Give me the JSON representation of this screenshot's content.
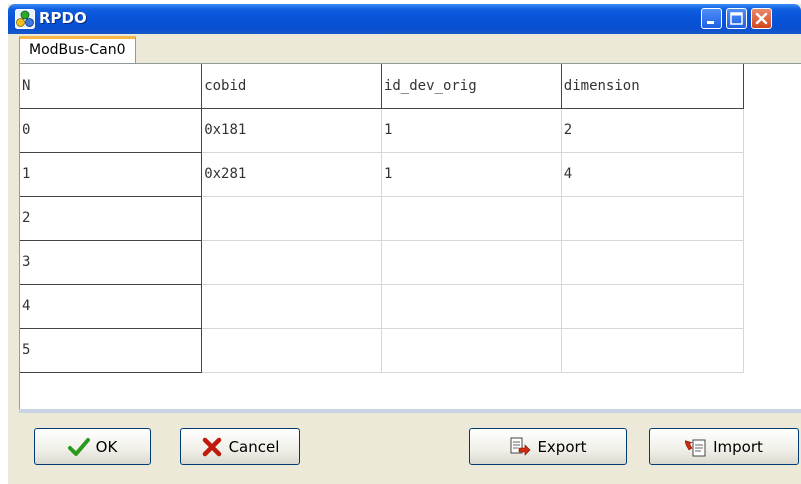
{
  "window": {
    "title": "RPDO",
    "app_icon": "network-nodes-icon",
    "controls": [
      "minimize-icon",
      "maximize-icon",
      "close-icon"
    ]
  },
  "tabs": [
    {
      "label": "ModBus-Can0",
      "active": true
    }
  ],
  "table": {
    "columns": [
      "N",
      "cobid",
      "id_dev_orig",
      "dimension"
    ],
    "rows": [
      [
        "0",
        "0x181",
        "1",
        "2"
      ],
      [
        "1",
        "0x281",
        "1",
        "4"
      ],
      [
        "2",
        "",
        "",
        ""
      ],
      [
        "3",
        "",
        "",
        ""
      ],
      [
        "4",
        "",
        "",
        ""
      ],
      [
        "5",
        "",
        "",
        ""
      ]
    ]
  },
  "buttons": {
    "ok": {
      "label": "OK",
      "icon": "checkmark-icon"
    },
    "cancel": {
      "label": "Cancel",
      "icon": "x-mark-icon"
    },
    "export": {
      "label": "Export",
      "icon": "export-icon"
    },
    "import": {
      "label": "Import",
      "icon": "import-icon"
    }
  },
  "colors": {
    "titlebar": "#0853d8",
    "tab_accent": "#f7b64a",
    "ok_check": "#2a9a1e",
    "cancel_x": "#c01a0e"
  }
}
